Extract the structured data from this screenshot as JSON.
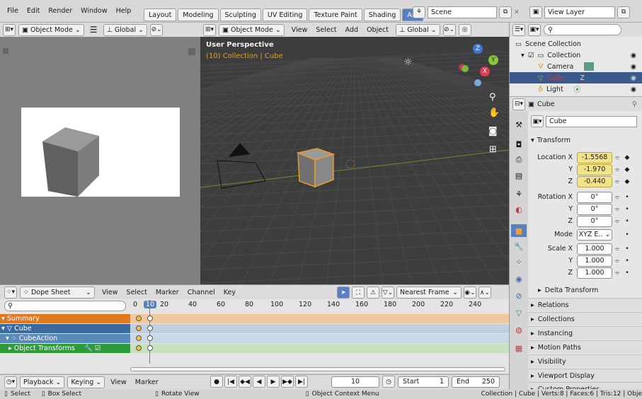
{
  "menu": [
    "File",
    "Edit",
    "Render",
    "Window",
    "Help"
  ],
  "workspace_tabs": [
    "Layout",
    "Modeling",
    "Sculpting",
    "UV Editing",
    "Texture Paint",
    "Shading",
    "Anim"
  ],
  "active_tab_index": 6,
  "scene_name": "Scene",
  "view_layer": "View Layer",
  "camera_view": {
    "mode": "Object Mode"
  },
  "viewport": {
    "mode": "Object Mode",
    "menu": [
      "View",
      "Select",
      "Add",
      "Object"
    ],
    "orientation": "Global",
    "perspective_title": "User Perspective",
    "perspective_subtitle": "(10) Collection | Cube",
    "gizmo": {
      "z": "Z",
      "y": "Y",
      "x": "X"
    }
  },
  "outliner": {
    "search_placeholder": "",
    "root": "Scene Collection",
    "items": [
      {
        "label": "Collection",
        "indent": 1
      },
      {
        "label": "Camera",
        "indent": 2
      },
      {
        "label": "Cube",
        "indent": 2,
        "selected": true
      },
      {
        "label": "Light",
        "indent": 2
      }
    ]
  },
  "properties": {
    "object_name": "Cube",
    "data_name": "Cube",
    "transform_header": "Transform",
    "location": {
      "label": "Location X",
      "x": "-1.5568",
      "y": "-1.970",
      "z": "-0.440"
    },
    "rotation": {
      "label": "Rotation X",
      "x": "0°",
      "y": "0°",
      "z": "0°"
    },
    "mode_label": "Mode",
    "mode_value": "XYZ E..",
    "scale": {
      "label": "Scale X",
      "x": "1.000",
      "y": "1.000",
      "z": "1.000"
    },
    "axis_y": "Y",
    "axis_z": "Z",
    "sections": [
      "Delta Transform",
      "Relations",
      "Collections",
      "Instancing",
      "Motion Paths",
      "Visibility",
      "Viewport Display",
      "Custom Properties"
    ]
  },
  "dopesheet": {
    "editor": "Dope Sheet",
    "menu": [
      "View",
      "Select",
      "Marker",
      "Channel",
      "Key"
    ],
    "snap": "Nearest Frame",
    "current_frame_label": "10",
    "ruler": [
      "0",
      "20",
      "40",
      "60",
      "80",
      "100",
      "120",
      "140",
      "160",
      "180",
      "200",
      "220",
      "240"
    ],
    "channels": [
      {
        "label": "Summary",
        "color": "#e07820"
      },
      {
        "label": "Cube",
        "color": "#3a6aa0"
      },
      {
        "label": "CubeAction",
        "color": "#5a8ab8"
      },
      {
        "label": "Object Transforms",
        "color": "#2f9a3a"
      }
    ]
  },
  "timeline": {
    "menu": [
      "Playback",
      "Keying",
      "View",
      "Marker"
    ],
    "frame": "10",
    "start_label": "Start",
    "start": "1",
    "end_label": "End",
    "end": "250"
  },
  "statusbar": {
    "select": "Select",
    "box_select": "Box Select",
    "rotate_view": "Rotate View",
    "context_menu": "Object Context Menu",
    "stats": "Collection | Cube | Verts:8 | Faces:6 | Tris:12 | Obje"
  }
}
